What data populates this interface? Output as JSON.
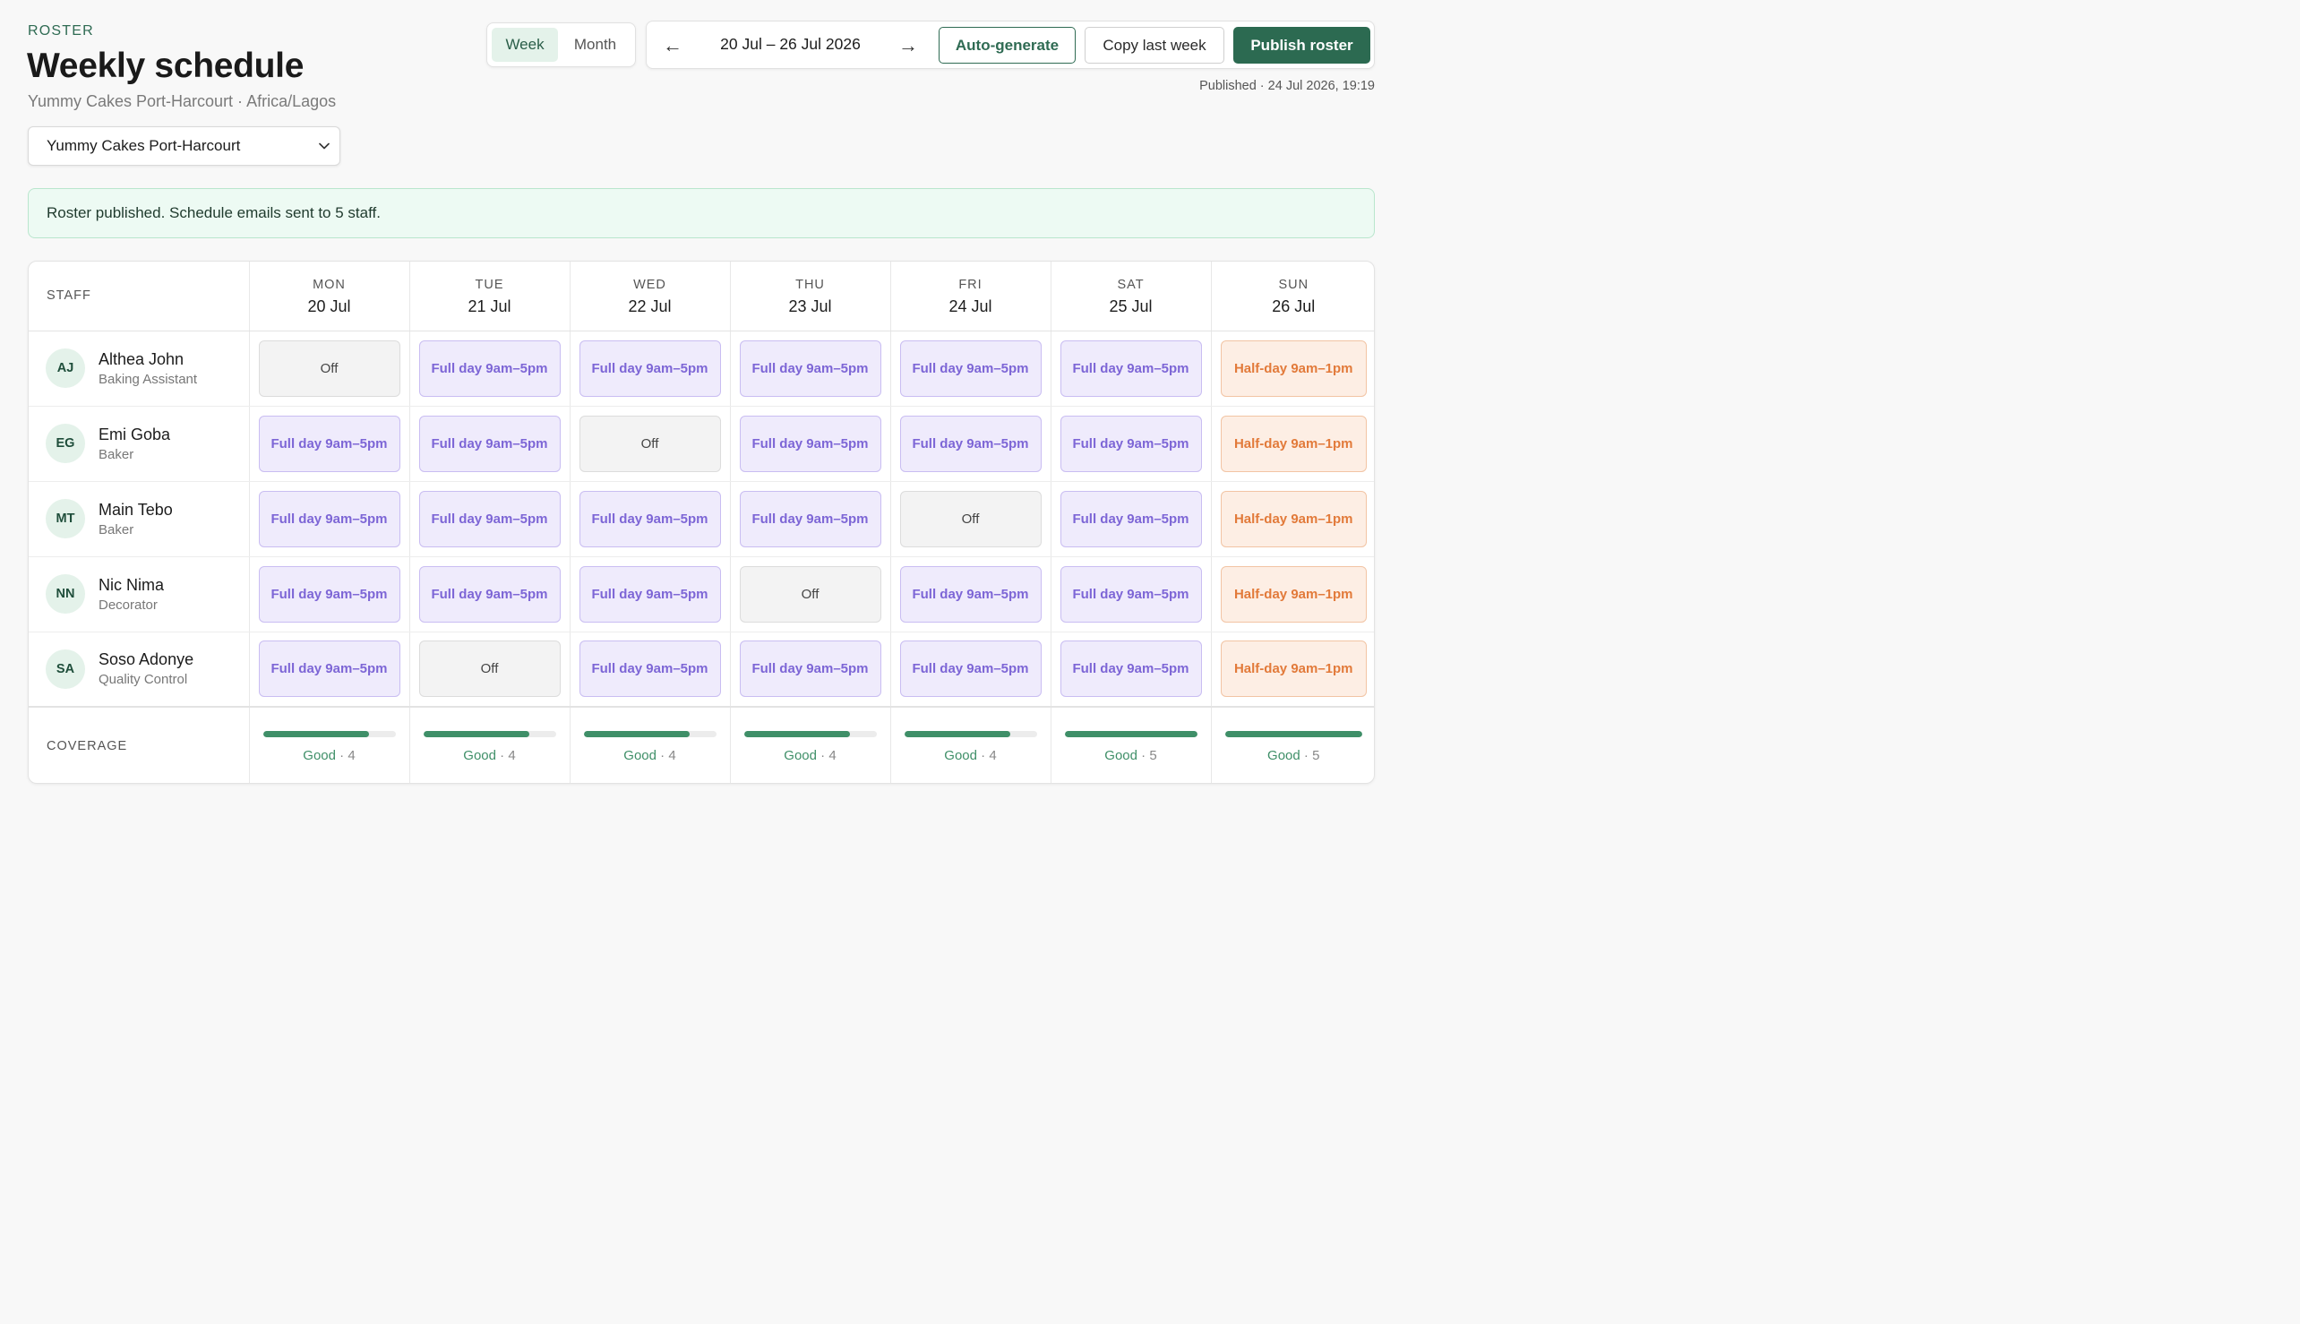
{
  "header": {
    "eyebrow": "ROSTER",
    "title": "Weekly schedule",
    "subtitle": "Yummy Cakes Port-Harcourt · Africa/Lagos",
    "location_select": "Yummy Cakes Port-Harcourt"
  },
  "view_toggle": {
    "week": "Week",
    "month": "Month",
    "active": "Week"
  },
  "toolbar": {
    "prev_arrow": "←",
    "next_arrow": "→",
    "date_range": "20 Jul – 26 Jul 2026",
    "auto_generate": "Auto-generate",
    "copy_last_week": "Copy last week",
    "publish": "Publish roster"
  },
  "published_note": "Published · 24 Jul 2026, 19:19",
  "alert": "Roster published. Schedule emails sent to 5 staff.",
  "colors": {
    "brand": "#2c6a51",
    "full_day": "#7d66d6",
    "half_day": "#e27a3a",
    "coverage": "#3f8f68"
  },
  "grid": {
    "staff_header": "STAFF",
    "coverage_label": "COVERAGE",
    "days": [
      {
        "dow": "MON",
        "date": "20 Jul"
      },
      {
        "dow": "TUE",
        "date": "21 Jul"
      },
      {
        "dow": "WED",
        "date": "22 Jul"
      },
      {
        "dow": "THU",
        "date": "23 Jul"
      },
      {
        "dow": "FRI",
        "date": "24 Jul"
      },
      {
        "dow": "SAT",
        "date": "25 Jul"
      },
      {
        "dow": "SUN",
        "date": "26 Jul"
      }
    ],
    "staff": [
      {
        "initials": "AJ",
        "name": "Althea John",
        "role": "Baking Assistant",
        "shifts": [
          {
            "type": "off",
            "label": "Off"
          },
          {
            "type": "full",
            "label": "Full day 9am–5pm"
          },
          {
            "type": "full",
            "label": "Full day 9am–5pm"
          },
          {
            "type": "full",
            "label": "Full day 9am–5pm"
          },
          {
            "type": "full",
            "label": "Full day 9am–5pm"
          },
          {
            "type": "full",
            "label": "Full day 9am–5pm"
          },
          {
            "type": "half",
            "label": "Half-day 9am–1pm"
          }
        ]
      },
      {
        "initials": "EG",
        "name": "Emi Goba",
        "role": "Baker",
        "shifts": [
          {
            "type": "full",
            "label": "Full day 9am–5pm"
          },
          {
            "type": "full",
            "label": "Full day 9am–5pm"
          },
          {
            "type": "off",
            "label": "Off"
          },
          {
            "type": "full",
            "label": "Full day 9am–5pm"
          },
          {
            "type": "full",
            "label": "Full day 9am–5pm"
          },
          {
            "type": "full",
            "label": "Full day 9am–5pm"
          },
          {
            "type": "half",
            "label": "Half-day 9am–1pm"
          }
        ]
      },
      {
        "initials": "MT",
        "name": "Main Tebo",
        "role": "Baker",
        "shifts": [
          {
            "type": "full",
            "label": "Full day 9am–5pm"
          },
          {
            "type": "full",
            "label": "Full day 9am–5pm"
          },
          {
            "type": "full",
            "label": "Full day 9am–5pm"
          },
          {
            "type": "full",
            "label": "Full day 9am–5pm"
          },
          {
            "type": "off",
            "label": "Off"
          },
          {
            "type": "full",
            "label": "Full day 9am–5pm"
          },
          {
            "type": "half",
            "label": "Half-day 9am–1pm"
          }
        ]
      },
      {
        "initials": "NN",
        "name": "Nic Nima",
        "role": "Decorator",
        "shifts": [
          {
            "type": "full",
            "label": "Full day 9am–5pm"
          },
          {
            "type": "full",
            "label": "Full day 9am–5pm"
          },
          {
            "type": "full",
            "label": "Full day 9am–5pm"
          },
          {
            "type": "off",
            "label": "Off"
          },
          {
            "type": "full",
            "label": "Full day 9am–5pm"
          },
          {
            "type": "full",
            "label": "Full day 9am–5pm"
          },
          {
            "type": "half",
            "label": "Half-day 9am–1pm"
          }
        ]
      },
      {
        "initials": "SA",
        "name": "Soso Adonye",
        "role": "Quality Control",
        "shifts": [
          {
            "type": "full",
            "label": "Full day 9am–5pm"
          },
          {
            "type": "off",
            "label": "Off"
          },
          {
            "type": "full",
            "label": "Full day 9am–5pm"
          },
          {
            "type": "full",
            "label": "Full day 9am–5pm"
          },
          {
            "type": "full",
            "label": "Full day 9am–5pm"
          },
          {
            "type": "full",
            "label": "Full day 9am–5pm"
          },
          {
            "type": "half",
            "label": "Half-day 9am–1pm"
          }
        ]
      }
    ],
    "coverage": [
      {
        "status": "Good",
        "count": "4",
        "fill": 0.8
      },
      {
        "status": "Good",
        "count": "4",
        "fill": 0.8
      },
      {
        "status": "Good",
        "count": "4",
        "fill": 0.8
      },
      {
        "status": "Good",
        "count": "4",
        "fill": 0.8
      },
      {
        "status": "Good",
        "count": "4",
        "fill": 0.8
      },
      {
        "status": "Good",
        "count": "5",
        "fill": 1.0
      },
      {
        "status": "Good",
        "count": "5",
        "fill": 1.0
      }
    ]
  }
}
